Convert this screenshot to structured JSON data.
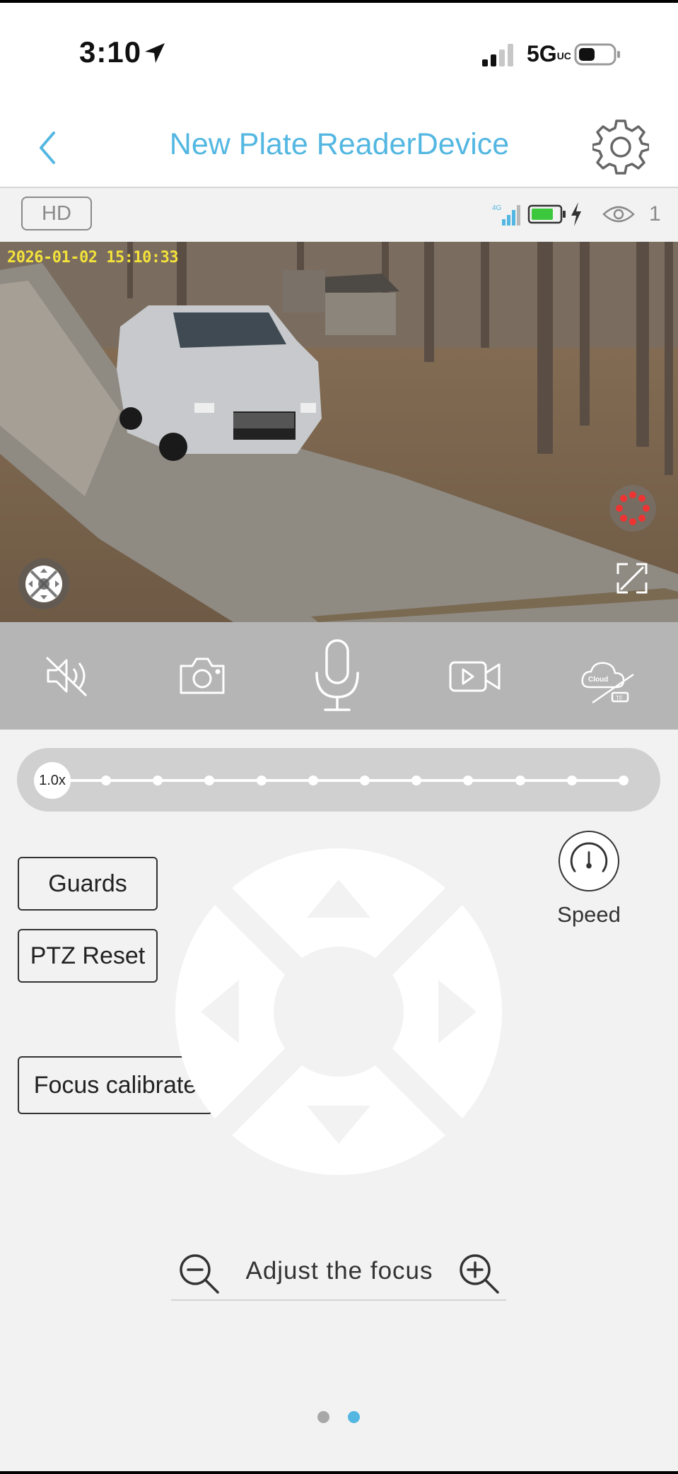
{
  "status_bar": {
    "time": "3:10",
    "network": "5G",
    "network_sup": "UC",
    "icons": [
      "location-arrow-icon",
      "cell-signal-icon",
      "battery-icon"
    ]
  },
  "header": {
    "title": "New Plate ReaderDevice",
    "back_icon": "chevron-left-icon",
    "settings_icon": "gear-icon",
    "accent_color": "#53b7e1"
  },
  "info_bar": {
    "quality": "HD",
    "cell_badge": "4G",
    "viewers": "1",
    "icons": [
      "cell-signal-icon",
      "battery-icon",
      "charging-bolt-icon",
      "eye-icon"
    ]
  },
  "video": {
    "timestamp": "2026-01-02 15:10:33",
    "overlay_icons": [
      "ptz-joystick-icon",
      "record-indicator-icon",
      "fullscreen-icon"
    ]
  },
  "toolbar": {
    "buttons": [
      "mute-icon",
      "snapshot-camera-icon",
      "microphone-icon",
      "record-video-icon",
      "cloud-tf-icon"
    ],
    "cloud_text": "Cloud",
    "tf_text": "TF"
  },
  "zoom": {
    "level": "1.0x",
    "stops": 12
  },
  "controls": {
    "guards_label": "Guards",
    "ptz_reset_label": "PTZ Reset",
    "focus_calibrate_label": "Focus calibrate",
    "speed_label": "Speed",
    "speed_icon": "speedometer-icon",
    "dpad_icons": [
      "arrow-up-icon",
      "arrow-down-icon",
      "arrow-left-icon",
      "arrow-right-icon"
    ]
  },
  "focus": {
    "label": "Adjust the focus",
    "minus_icon": "zoom-out-icon",
    "plus_icon": "zoom-in-icon"
  },
  "pager": {
    "pages": 2,
    "active": 2
  }
}
